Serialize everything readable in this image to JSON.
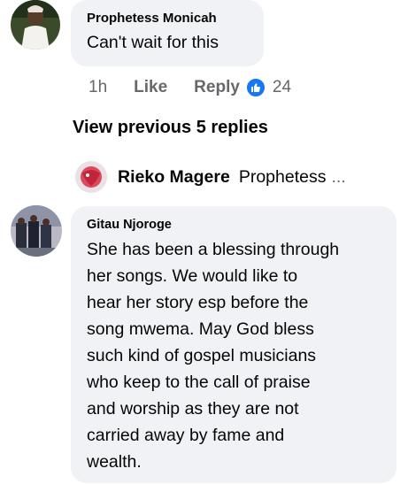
{
  "comment1": {
    "author": "Prophetess Monicah",
    "text": "Can't wait for this",
    "time": "1h",
    "like_label": "Like",
    "reply_label": "Reply",
    "reaction_icon": "thumbs-up-icon",
    "reaction_color": "#1877f2",
    "reaction_count": "24"
  },
  "view_previous": "View previous 5 replies",
  "reply_preview": {
    "author": "Rieko Magere",
    "snippet": "Prophetess",
    "ellipsis": "..."
  },
  "comment2": {
    "author": "Gitau Njoroge",
    "lines": [
      "She has been a blessing through",
      "her songs. We would like to",
      "hear her story esp before the",
      "song mwema. May God bless",
      "such kind of gospel musicians",
      "who keep to the call of praise",
      "and worship as they are not",
      "carried away by fame and",
      "wealth."
    ]
  },
  "colors": {
    "bubble": "#f0f2f5",
    "meta_text": "#65676b",
    "primary_text": "#050505"
  }
}
